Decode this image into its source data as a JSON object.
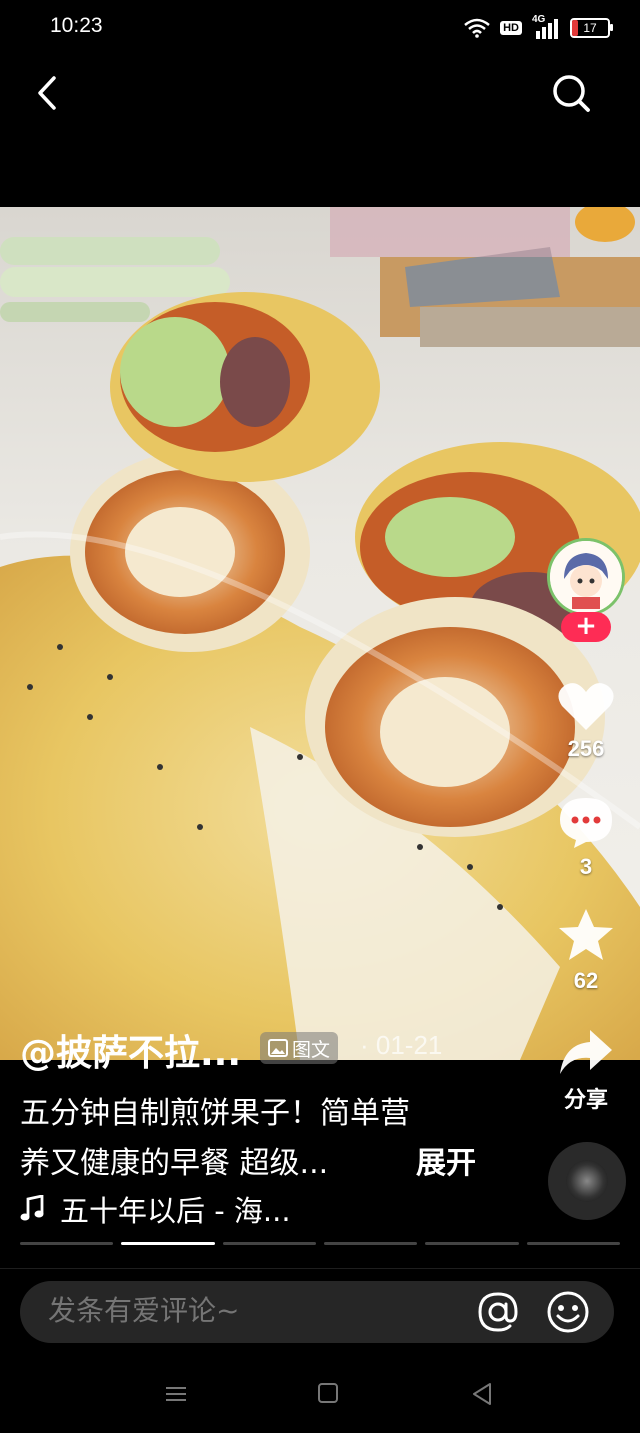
{
  "status_bar": {
    "time": "10:23",
    "network": "4G",
    "hd_label": "HD",
    "battery": "17",
    "battery_level": 0.17
  },
  "post": {
    "author": "@披萨不拉...",
    "type_label": "图文",
    "date": "· 01-21",
    "description_line1": "五分钟自制煎饼果子！简单营",
    "description_line2": "养又健康的早餐 超级...",
    "expand_label": "展开",
    "music": "五十年以后 - 海..."
  },
  "actions": {
    "follow_label": "+",
    "likes": "256",
    "comments": "3",
    "favorites": "62",
    "share_label": "分享"
  },
  "carousel": {
    "total": 6,
    "active_index": 1
  },
  "comment": {
    "placeholder": "发条有爱评论~"
  },
  "colors": {
    "accent": "#fe2c55",
    "battery_low": "#e23a3a",
    "background": "#000000"
  }
}
